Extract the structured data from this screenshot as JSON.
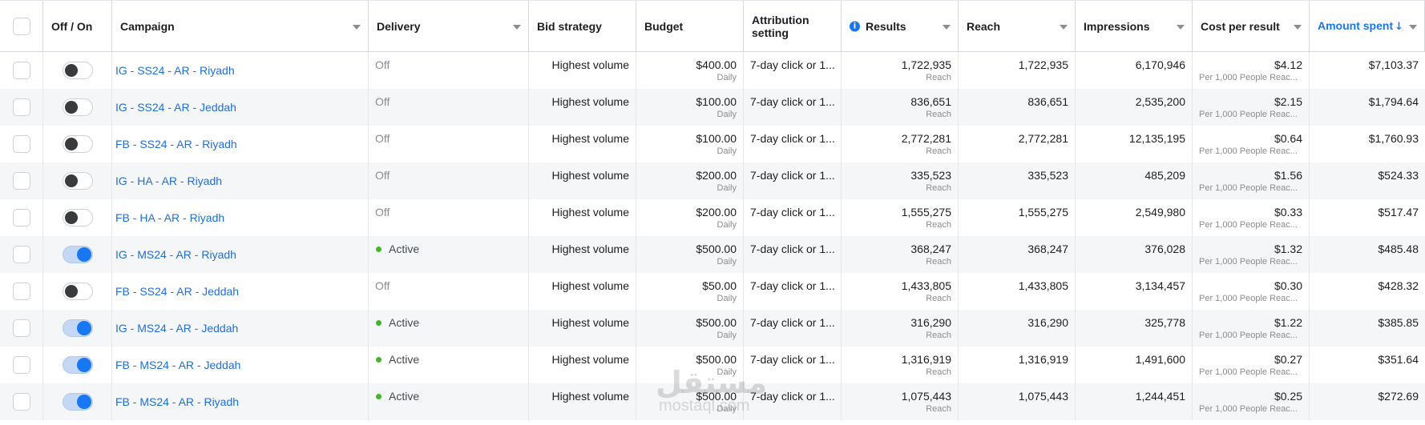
{
  "header": {
    "off_on": "Off / On",
    "campaign": "Campaign",
    "delivery": "Delivery",
    "bid_strategy": "Bid strategy",
    "budget": "Budget",
    "attribution": "Attribution setting",
    "results": "Results",
    "reach": "Reach",
    "impressions": "Impressions",
    "cost_per_result": "Cost per result",
    "amount_spent": "Amount spent",
    "sort_indicator": "↓",
    "info_icon": "i"
  },
  "colors": {
    "link": "#216fdb",
    "accent": "#1877f2",
    "active_dot": "#42b72a",
    "row_alt": "#f5f6f7"
  },
  "rows": [
    {
      "on": false,
      "campaign": "IG - SS24 - AR - Riyadh",
      "delivery": "Off",
      "active": false,
      "bid": "Highest volume",
      "budget": "$400.00",
      "budget_period": "Daily",
      "attribution": "7-day click or 1...",
      "results": "1,722,935",
      "results_type": "Reach",
      "reach": "1,722,935",
      "impressions": "6,170,946",
      "cpr": "$4.12",
      "cpr_type": "Per 1,000 People Reac...",
      "spent": "$7,103.37"
    },
    {
      "on": false,
      "campaign": "IG - SS24 - AR - Jeddah",
      "delivery": "Off",
      "active": false,
      "bid": "Highest volume",
      "budget": "$100.00",
      "budget_period": "Daily",
      "attribution": "7-day click or 1...",
      "results": "836,651",
      "results_type": "Reach",
      "reach": "836,651",
      "impressions": "2,535,200",
      "cpr": "$2.15",
      "cpr_type": "Per 1,000 People Reac...",
      "spent": "$1,794.64"
    },
    {
      "on": false,
      "campaign": "FB - SS24 - AR - Riyadh",
      "delivery": "Off",
      "active": false,
      "bid": "Highest volume",
      "budget": "$100.00",
      "budget_period": "Daily",
      "attribution": "7-day click or 1...",
      "results": "2,772,281",
      "results_type": "Reach",
      "reach": "2,772,281",
      "impressions": "12,135,195",
      "cpr": "$0.64",
      "cpr_type": "Per 1,000 People Reac...",
      "spent": "$1,760.93"
    },
    {
      "on": false,
      "campaign": "IG - HA - AR - Riyadh",
      "delivery": "Off",
      "active": false,
      "bid": "Highest volume",
      "budget": "$200.00",
      "budget_period": "Daily",
      "attribution": "7-day click or 1...",
      "results": "335,523",
      "results_type": "Reach",
      "reach": "335,523",
      "impressions": "485,209",
      "cpr": "$1.56",
      "cpr_type": "Per 1,000 People Reac...",
      "spent": "$524.33"
    },
    {
      "on": false,
      "campaign": "FB - HA - AR - Riyadh",
      "delivery": "Off",
      "active": false,
      "bid": "Highest volume",
      "budget": "$200.00",
      "budget_period": "Daily",
      "attribution": "7-day click or 1...",
      "results": "1,555,275",
      "results_type": "Reach",
      "reach": "1,555,275",
      "impressions": "2,549,980",
      "cpr": "$0.33",
      "cpr_type": "Per 1,000 People Reac...",
      "spent": "$517.47"
    },
    {
      "on": true,
      "campaign": "IG - MS24 - AR - Riyadh",
      "delivery": "Active",
      "active": true,
      "bid": "Highest volume",
      "budget": "$500.00",
      "budget_period": "Daily",
      "attribution": "7-day click or 1...",
      "results": "368,247",
      "results_type": "Reach",
      "reach": "368,247",
      "impressions": "376,028",
      "cpr": "$1.32",
      "cpr_type": "Per 1,000 People Reac...",
      "spent": "$485.48"
    },
    {
      "on": false,
      "campaign": "FB - SS24 - AR - Jeddah",
      "delivery": "Off",
      "active": false,
      "bid": "Highest volume",
      "budget": "$50.00",
      "budget_period": "Daily",
      "attribution": "7-day click or 1...",
      "results": "1,433,805",
      "results_type": "Reach",
      "reach": "1,433,805",
      "impressions": "3,134,457",
      "cpr": "$0.30",
      "cpr_type": "Per 1,000 People Reac...",
      "spent": "$428.32"
    },
    {
      "on": true,
      "campaign": "IG - MS24 - AR - Jeddah",
      "delivery": "Active",
      "active": true,
      "bid": "Highest volume",
      "budget": "$500.00",
      "budget_period": "Daily",
      "attribution": "7-day click or 1...",
      "results": "316,290",
      "results_type": "Reach",
      "reach": "316,290",
      "impressions": "325,778",
      "cpr": "$1.22",
      "cpr_type": "Per 1,000 People Reac...",
      "spent": "$385.85"
    },
    {
      "on": true,
      "campaign": "FB - MS24 - AR - Jeddah",
      "delivery": "Active",
      "active": true,
      "bid": "Highest volume",
      "budget": "$500.00",
      "budget_period": "Daily",
      "attribution": "7-day click or 1...",
      "results": "1,316,919",
      "results_type": "Reach",
      "reach": "1,316,919",
      "impressions": "1,491,600",
      "cpr": "$0.27",
      "cpr_type": "Per 1,000 People Reac...",
      "spent": "$351.64"
    },
    {
      "on": true,
      "campaign": "FB - MS24 - AR - Riyadh",
      "delivery": "Active",
      "active": true,
      "bid": "Highest volume",
      "budget": "$500.00",
      "budget_period": "Daily",
      "attribution": "7-day click or 1...",
      "results": "1,075,443",
      "results_type": "Reach",
      "reach": "1,075,443",
      "impressions": "1,244,451",
      "cpr": "$0.25",
      "cpr_type": "Per 1,000 People Reac...",
      "spent": "$272.69"
    }
  ],
  "watermark": {
    "arabic": "مستقل",
    "latin": "mostaql.com"
  }
}
